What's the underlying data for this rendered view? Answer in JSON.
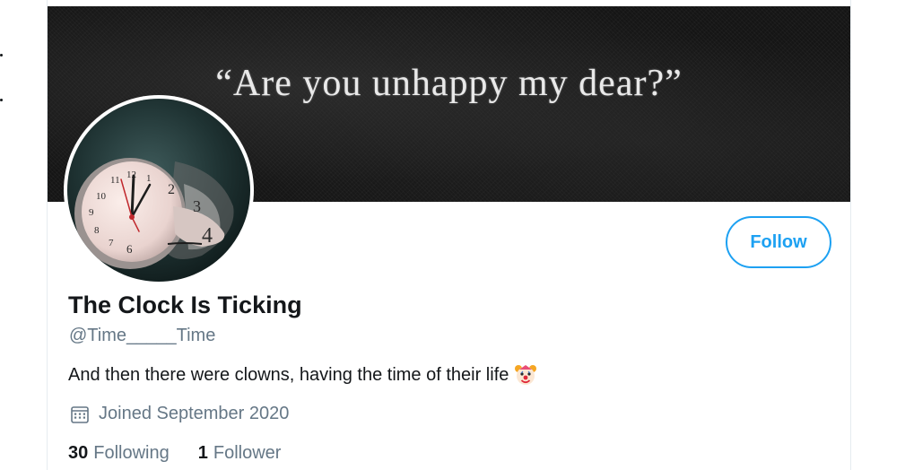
{
  "banner": {
    "quote": "“Are you unhappy my dear?”"
  },
  "profile": {
    "display_name": "The Clock Is Ticking",
    "handle": "@Time_____Time",
    "bio": "And then there were clowns, having the time of their life",
    "bio_emoji": "clown-face-icon",
    "joined": "Joined September 2020"
  },
  "actions": {
    "follow_label": "Follow"
  },
  "stats": {
    "following_count": "30",
    "following_label": "Following",
    "followers_count": "1",
    "followers_label": "Follower"
  },
  "avatar": {
    "clock_numbers": [
      "11",
      "12",
      "1",
      "2",
      "3",
      "4",
      "10",
      "9",
      "8",
      "7",
      "6"
    ]
  },
  "icons": {
    "calendar": "calendar-icon",
    "clown": "clown-face-icon"
  },
  "colors": {
    "accent": "#1da1f2",
    "primary_text": "#14171a",
    "secondary_text": "#657786",
    "border": "#e6ecf0"
  }
}
